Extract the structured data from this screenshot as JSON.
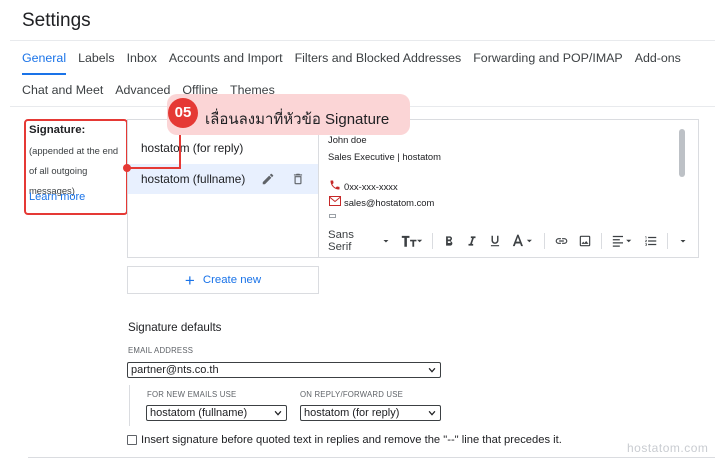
{
  "page": {
    "title": "Settings"
  },
  "tabs": {
    "row1": [
      "General",
      "Labels",
      "Inbox",
      "Accounts and Import",
      "Filters and Blocked Addresses",
      "Forwarding and POP/IMAP",
      "Add-ons"
    ],
    "row2": [
      "Chat and Meet",
      "Advanced",
      "Offline",
      "Themes"
    ],
    "active": "General"
  },
  "signature_section": {
    "heading": "Signature:",
    "description": "(appended at the end of all outgoing messages)",
    "learn_more": "Learn more"
  },
  "signatures": [
    {
      "name": "hostatom (for reply)"
    },
    {
      "name": "hostatom (fullname)",
      "selected": true
    }
  ],
  "editor": {
    "name_line": "John doe",
    "title_line": "Sales Executive | hostatom",
    "phone": "0xx-xxx-xxxx",
    "email": "sales@hostatom.com",
    "toolbar": {
      "font": "Sans Serif"
    }
  },
  "callout": {
    "number": "05",
    "text": "เลื่อนลงมาที่หัวข้อ Signature"
  },
  "create_new": {
    "label": "Create new"
  },
  "defaults": {
    "heading": "Signature defaults",
    "email_label": "EMAIL ADDRESS",
    "email_value": "partner@nts.co.th",
    "new_label": "FOR NEW EMAILS USE",
    "new_value": "hostatom (fullname)",
    "reply_label": "ON REPLY/FORWARD USE",
    "reply_value": "hostatom (for reply)"
  },
  "insert_option": {
    "label": "Insert signature before quoted text in replies and remove the \"--\" line that precedes it."
  },
  "watermark": "hostatom.com",
  "colors": {
    "accent": "#1a73e8",
    "annotation": "#e53935",
    "callout_bg": "#fbd5d6",
    "selected_bg": "#e8f0fe"
  }
}
